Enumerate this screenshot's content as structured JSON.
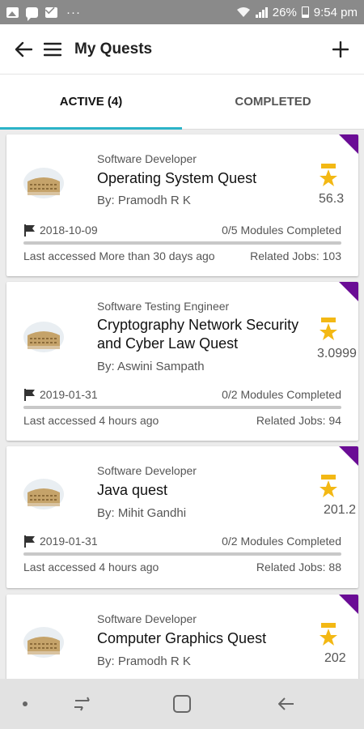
{
  "status_bar": {
    "battery": "26%",
    "time": "9:54 pm",
    "left_icons": [
      "image-icon",
      "message-icon",
      "mail-icon"
    ],
    "more": "···"
  },
  "app_bar": {
    "title": "My Quests",
    "back_icon": "arrow-left-icon",
    "menu_icon": "hamburger-icon",
    "add_icon": "plus-icon"
  },
  "tabs": [
    {
      "label": "ACTIVE (4)",
      "active": true
    },
    {
      "label": "COMPLETED",
      "active": false
    }
  ],
  "colors": {
    "accent": "#2bb3c8",
    "corner": "#6a0c95",
    "star": "#f3b814"
  },
  "quests": [
    {
      "role": "Software Developer",
      "title": "Operating System Quest",
      "author": "By: Pramodh R K",
      "score": "56.3",
      "date": "2018-10-09",
      "modules": "0/5 Modules Completed",
      "last_accessed": "Last accessed More than 30 days ago",
      "related_jobs": "Related Jobs: 103"
    },
    {
      "role": "Software Testing Engineer",
      "title": "Cryptography Network Security and Cyber Law Quest",
      "author": "By: Aswini Sampath",
      "score": "3.0999",
      "date": "2019-01-31",
      "modules": "0/2 Modules Completed",
      "last_accessed": "Last accessed 4 hours ago",
      "related_jobs": "Related Jobs: 94"
    },
    {
      "role": "Software Developer",
      "title": "Java quest",
      "author": "By: Mihit Gandhi",
      "score": "201.2",
      "date": "2019-01-31",
      "modules": "0/2 Modules Completed",
      "last_accessed": "Last accessed 4 hours ago",
      "related_jobs": "Related Jobs: 88"
    },
    {
      "role": "Software Developer",
      "title": "Computer Graphics Quest",
      "author": "By: Pramodh R K",
      "score": "202"
    }
  ]
}
